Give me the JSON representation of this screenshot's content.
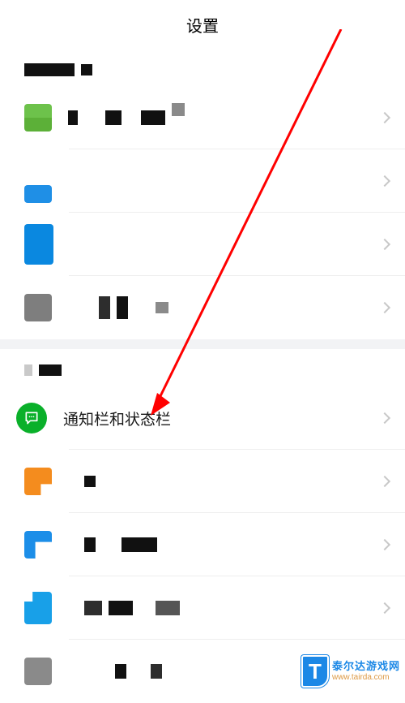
{
  "header": {
    "title": "设置"
  },
  "sections": [
    {
      "rows": [
        {
          "kind": "header"
        },
        {
          "chevron": true
        },
        {
          "chevron": true
        },
        {
          "chevron": true
        },
        {
          "chevron": true
        }
      ]
    },
    {
      "rows": [
        {
          "kind": "header"
        },
        {
          "label": "通知栏和状态栏",
          "chevron": true,
          "icon": "chat"
        },
        {
          "chevron": true
        },
        {
          "chevron": true
        },
        {
          "chevron": true
        },
        {
          "chevron": false
        }
      ]
    }
  ],
  "watermark": {
    "logo_letter": "T",
    "brand_cn": "泰尔达游戏网",
    "url": "www.tairda.com"
  },
  "annotation": {
    "type": "arrow",
    "color": "#ff0000"
  }
}
